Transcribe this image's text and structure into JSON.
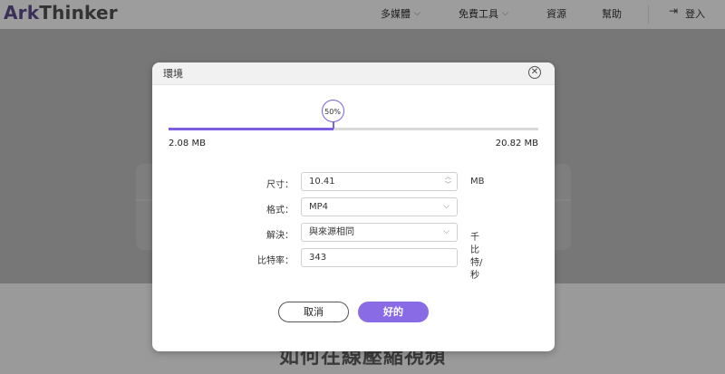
{
  "header": {
    "logo_ark": "Ark",
    "logo_thinker": "Thinker",
    "nav": [
      {
        "label": "多媒體",
        "has_dropdown": true
      },
      {
        "label": "免費工具",
        "has_dropdown": true
      },
      {
        "label": "資源",
        "has_dropdown": false
      },
      {
        "label": "幫助",
        "has_dropdown": false
      }
    ],
    "login_label": "登入",
    "login_icon": "sign-in-icon"
  },
  "background": {
    "heading": "如何在線壓縮視頻"
  },
  "modal": {
    "title": "環境",
    "close_icon": "close-icon",
    "slider": {
      "value_label": "50%",
      "fraction": 0.445,
      "min_label": "2.08 MB",
      "max_label": "20.82 MB"
    },
    "fields": {
      "size": {
        "label": "尺寸：",
        "value": "10.41",
        "unit": "MB"
      },
      "format": {
        "label": "格式：",
        "value": "MP4"
      },
      "resolution": {
        "label": "解決：",
        "value": "與來源相同"
      },
      "bitrate": {
        "label": "比特率：",
        "value": "343",
        "unit": "千比特/秒"
      }
    },
    "buttons": {
      "cancel": "取消",
      "ok": "好的"
    }
  },
  "colors": {
    "accent": "#7b5fe0",
    "ok_button": "#8a6be6",
    "overlay": "#7b7b7b"
  }
}
